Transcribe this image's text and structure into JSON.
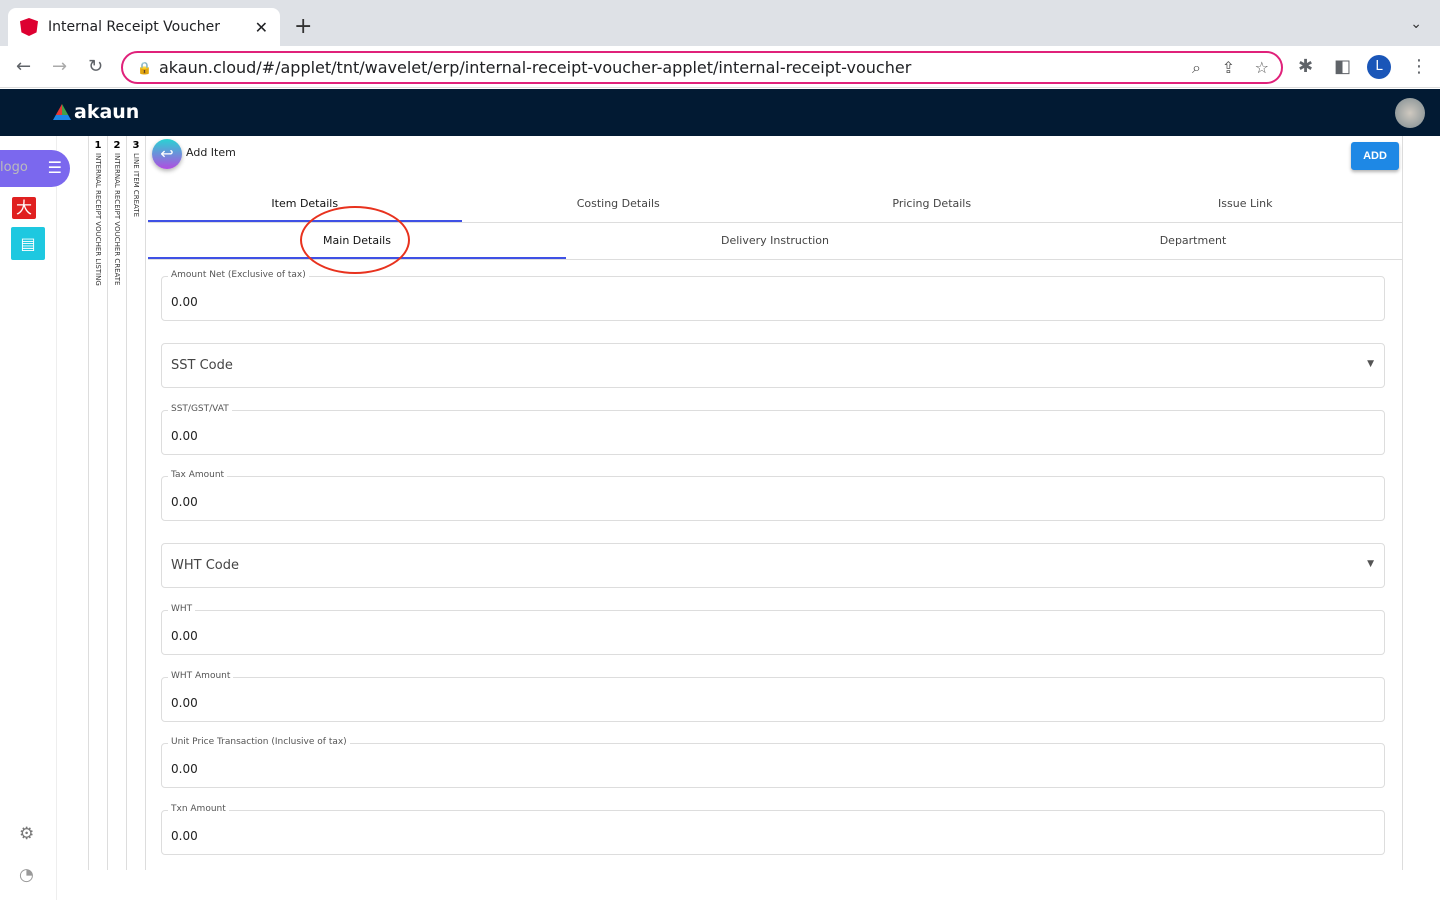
{
  "browser": {
    "tab_title": "Internal Receipt Voucher",
    "url": "akaun.cloud/#/applet/tnt/wavelet/erp/internal-receipt-voucher-applet/internal-receipt-voucher",
    "profile_initial": "L"
  },
  "app": {
    "logo_text": "akaun"
  },
  "sidebar": {
    "logo_alt": "logo"
  },
  "breadcrumbs": [
    {
      "n": "1",
      "label": "INTERNAL RECEIPT VOUCHER LISTING"
    },
    {
      "n": "2",
      "label": "INTERNAL RECEIPT VOUCHER CREATE"
    },
    {
      "n": "3",
      "label": "LINE ITEM CREATE"
    }
  ],
  "panel": {
    "title": "Add Item",
    "add_label": "ADD"
  },
  "tabs": [
    "Item Details",
    "Costing Details",
    "Pricing Details",
    "Issue Link"
  ],
  "subtabs": [
    "Main Details",
    "Delivery Instruction",
    "Department"
  ],
  "fields": [
    {
      "label": "Amount Net (Exclusive of tax)",
      "value": "0.00"
    },
    {
      "placeholder": "SST Code",
      "select": true
    },
    {
      "label": "SST/GST/VAT",
      "value": "0.00"
    },
    {
      "label": "Tax Amount",
      "value": "0.00"
    },
    {
      "placeholder": "WHT Code",
      "select": true
    },
    {
      "label": "WHT",
      "value": "0.00"
    },
    {
      "label": "WHT Amount",
      "value": "0.00"
    },
    {
      "label": "Unit Price Transaction (Inclusive of tax)",
      "value": "0.00"
    },
    {
      "label": "Txn Amount",
      "value": "0.00"
    }
  ]
}
